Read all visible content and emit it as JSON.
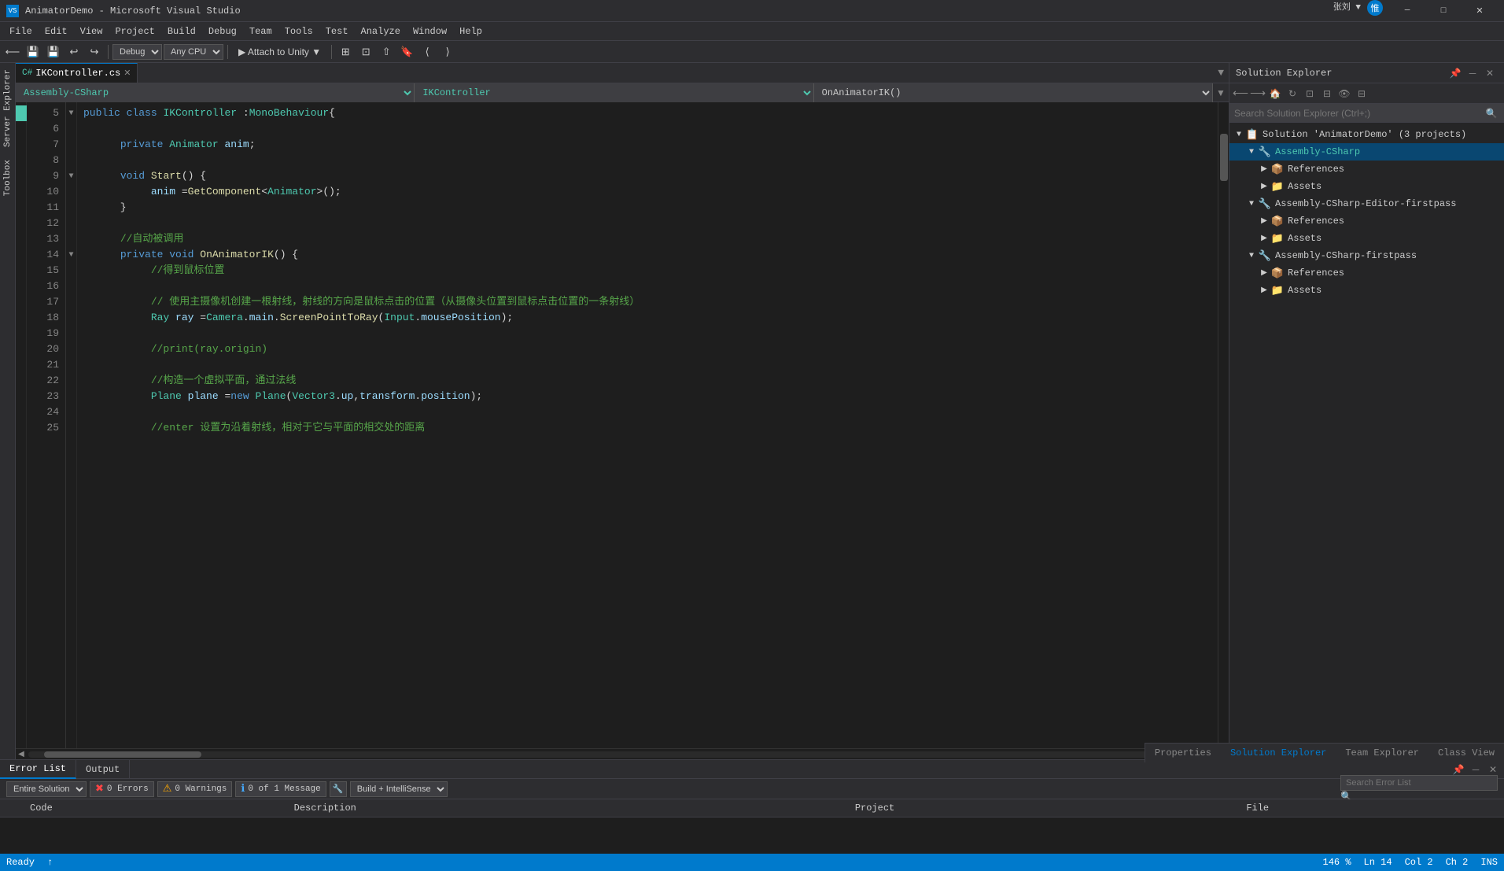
{
  "titlebar": {
    "title": "AnimatorDemo - Microsoft Visual Studio",
    "app_name": "VS",
    "min_label": "─",
    "max_label": "□",
    "close_label": "✕"
  },
  "menubar": {
    "items": [
      "File",
      "Edit",
      "View",
      "Project",
      "Build",
      "Debug",
      "Team",
      "Tools",
      "Test",
      "Analyze",
      "Window",
      "Help"
    ]
  },
  "toolbar": {
    "debug_config": "Debug",
    "platform": "Any CPU",
    "attach_label": "▶ Attach to Unity ▼",
    "zoom_label": "146 %"
  },
  "tab": {
    "filename": "IKController.cs",
    "close_label": "✕",
    "dropdown_label": "▼"
  },
  "nav": {
    "namespace": "Assembly-CSharp",
    "class": "IKController",
    "method": "OnAnimatorIK()"
  },
  "code": {
    "lines": [
      {
        "num": 5,
        "text_html": "<span class='kw'>public</span> <span class='kw'>class</span> <span class='type'>IKController</span> <span class='plain'>: </span><span class='type'>MonoBehaviour</span> <span class='plain'>{</span>",
        "fold": "▼",
        "indent": 0
      },
      {
        "num": 6,
        "text_html": "",
        "fold": "",
        "indent": 0
      },
      {
        "num": 7,
        "text_html": "<span class='kw'>private</span> <span class='type'>Animator</span> <span class='param'>anim</span><span class='plain'>;</span>",
        "fold": "",
        "indent": 2
      },
      {
        "num": 8,
        "text_html": "",
        "fold": "",
        "indent": 0
      },
      {
        "num": 9,
        "text_html": "<span class='kw'>void</span> <span class='method-name'>Start</span><span class='plain'>() {</span>",
        "fold": "▼",
        "indent": 2
      },
      {
        "num": 10,
        "text_html": "<span class='param'>anim</span> <span class='plain'>= </span><span class='method-name'>GetComponent</span><span class='plain'>&lt;</span><span class='type'>Animator</span><span class='plain'>&gt;();</span>",
        "fold": "",
        "indent": 4
      },
      {
        "num": 11,
        "text_html": "<span class='plain'>}</span>",
        "fold": "",
        "indent": 2
      },
      {
        "num": 12,
        "text_html": "",
        "fold": "",
        "indent": 0
      },
      {
        "num": 13,
        "text_html": "<span class='comment'>//自动被调用</span>",
        "fold": "",
        "indent": 2
      },
      {
        "num": 14,
        "text_html": "<span class='kw'>private</span> <span class='kw'>void</span> <span class='method-name'>OnAnimatorIK</span><span class='plain'>() {</span>",
        "fold": "▼",
        "indent": 2
      },
      {
        "num": 15,
        "text_html": "<span class='comment'>//得到鼠标位置</span>",
        "fold": "",
        "indent": 4
      },
      {
        "num": 16,
        "text_html": "",
        "fold": "",
        "indent": 0
      },
      {
        "num": 17,
        "text_html": "<span class='comment'>// 使用主摄像机创建一根射线，射线的方向是鼠标点击的位置（从摄像头位置到鼠标点击位置的一条射线）</span>",
        "fold": "",
        "indent": 4
      },
      {
        "num": 18,
        "text_html": "<span class='type'>Ray</span> <span class='param'>ray</span> <span class='plain'>= </span><span class='type'>Camera</span><span class='plain'>.</span><span class='param'>main</span><span class='plain'>.</span><span class='method-name'>ScreenPointToRay</span><span class='plain'>(</span><span class='type'>Input</span><span class='plain'>.</span><span class='param'>mousePosition</span><span class='plain'>);</span>",
        "fold": "",
        "indent": 4
      },
      {
        "num": 19,
        "text_html": "",
        "fold": "",
        "indent": 0
      },
      {
        "num": 20,
        "text_html": "<span class='comment'>//print(ray.origin)</span>",
        "fold": "",
        "indent": 4
      },
      {
        "num": 21,
        "text_html": "",
        "fold": "",
        "indent": 0
      },
      {
        "num": 22,
        "text_html": "<span class='comment'>//构造一个虚拟平面，通过法线</span>",
        "fold": "",
        "indent": 4
      },
      {
        "num": 23,
        "text_html": "<span class='type'>Plane</span> <span class='param'>plane</span> <span class='plain'>= </span><span class='kw'>new</span> <span class='type'>Plane</span><span class='plain'>(</span><span class='type'>Vector3</span><span class='plain'>.</span><span class='param'>up</span><span class='plain'>, </span><span class='param'>transform</span><span class='plain'>.</span><span class='param'>position</span><span class='plain'>);</span>",
        "fold": "",
        "indent": 4
      },
      {
        "num": 24,
        "text_html": "",
        "fold": "",
        "indent": 0
      },
      {
        "num": 25,
        "text_html": "<span class='comment'>//enter 设置为沿着射线，相对于它与平面的相交处的距离</span>",
        "fold": "",
        "indent": 4
      }
    ]
  },
  "solution_explorer": {
    "title": "Solution Explorer",
    "search_placeholder": "Search Solution Explorer (Ctrl+;)",
    "solution_label": "Solution 'AnimatorDemo' (3 projects)",
    "projects": [
      {
        "name": "Assembly-CSharp",
        "children": [
          {
            "name": "References",
            "type": "references",
            "expanded": false
          },
          {
            "name": "Assets",
            "type": "folder",
            "expanded": false
          }
        ]
      },
      {
        "name": "Assembly-CSharp-Editor-firstpass",
        "children": [
          {
            "name": "References",
            "type": "references",
            "expanded": false
          },
          {
            "name": "Assets",
            "type": "folder",
            "expanded": false
          }
        ]
      },
      {
        "name": "Assembly-CSharp-firstpass",
        "children": [
          {
            "name": "References",
            "type": "references",
            "expanded": false
          },
          {
            "name": "Assets",
            "type": "folder",
            "expanded": false
          }
        ]
      }
    ]
  },
  "error_list": {
    "title": "Error List",
    "output_label": "Output",
    "filter_label": "Entire Solution",
    "errors_label": "0 Errors",
    "warnings_label": "0 Warnings",
    "messages_label": "0 of 1 Message",
    "build_label": "Build + IntelliSense",
    "search_placeholder": "Search Error List",
    "columns": [
      "",
      "Code",
      "Description",
      "Project",
      "File"
    ],
    "rows": []
  },
  "statusbar": {
    "zoom": "146 %",
    "ready": "Ready",
    "user": "张刘",
    "user2": "惟"
  },
  "bottom_tabs": {
    "properties": "Properties",
    "solution_explorer": "Solution Explorer",
    "team_explorer": "Team Explorer",
    "class_view": "Class View"
  }
}
